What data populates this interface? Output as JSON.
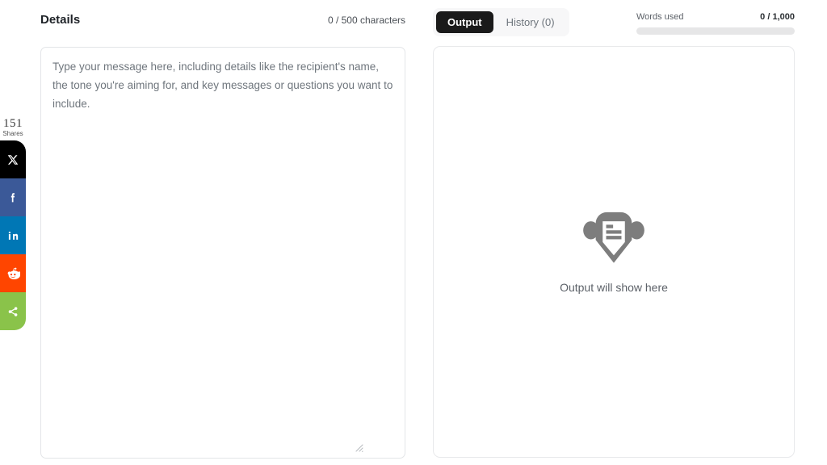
{
  "details": {
    "title": "Details",
    "char_counter": "0 / 500 characters",
    "textarea_value": "",
    "textarea_placeholder": "Type your message here, including details like the recipient's name, the tone you're aiming for, and key messages or questions you want to include."
  },
  "output": {
    "tabs": [
      {
        "label": "Output",
        "active": true
      },
      {
        "label": "History (0)",
        "active": false
      }
    ],
    "words": {
      "label": "Words used",
      "value": "0 / 1,000",
      "progress_percent": 0
    },
    "empty_state": {
      "icon": "document-shield-icon",
      "text": "Output will show here"
    }
  },
  "share_rail": {
    "count": "151",
    "count_label": "Shares",
    "buttons": [
      {
        "name": "x-twitter",
        "color": "#000000"
      },
      {
        "name": "facebook",
        "color": "#3b5998"
      },
      {
        "name": "linkedin",
        "color": "#0077b5"
      },
      {
        "name": "reddit",
        "color": "#ff4500"
      },
      {
        "name": "more-share",
        "color": "#8ac34a"
      }
    ]
  }
}
